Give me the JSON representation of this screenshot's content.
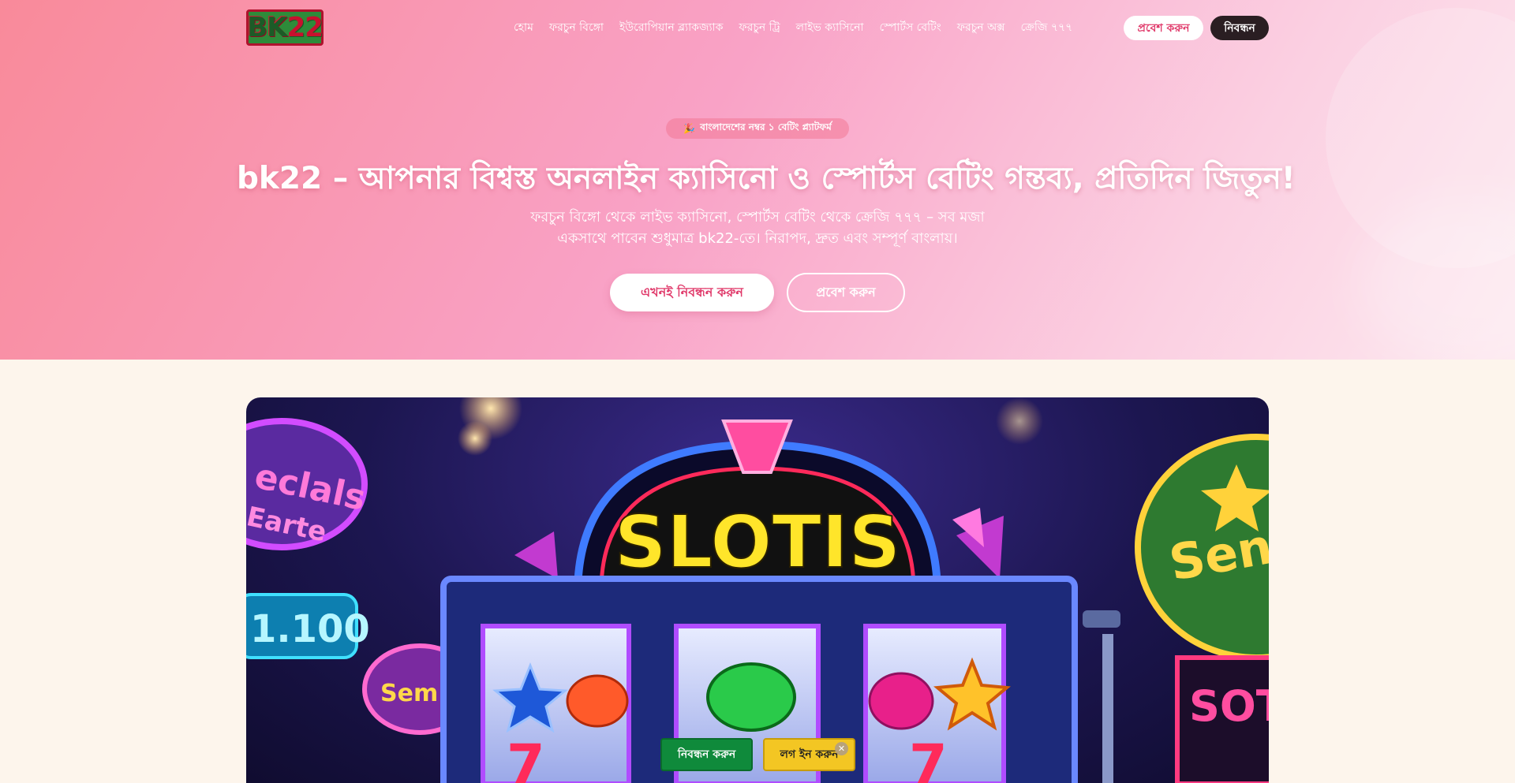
{
  "header": {
    "logo_text_a": "BK",
    "logo_text_b": "22",
    "nav": [
      "হোম",
      "ফরচুন বিঙ্গো",
      "ইউরোপিয়ান ব্ল্যাকজ্যাক",
      "ফরচুন ট্রি",
      "লাইভ ক্যাসিনো",
      "স্পোর্টস বেটিং",
      "ফরচুন অক্স",
      "ক্রেজি ৭৭৭"
    ],
    "login_label": "প্রবেশ করুন",
    "register_label": "নিবন্ধন"
  },
  "hero": {
    "badge_icon": "party-popper-icon",
    "badge_text": "বাংলাদেশের নম্বর ১ বেটিং প্ল্যাটফর্ম",
    "title": "bk22 – আপনার বিশ্বস্ত অনলাইন ক্যাসিনো ও স্পোর্টস বেটিং গন্তব্য, প্রতিদিন জিতুন!",
    "subtitle_line1": "ফরচুন বিঙ্গো থেকে লাইভ ক্যাসিনো, স্পোর্টস বেটিং থেকে ক্রেজি ৭৭৭ – সব মজা",
    "subtitle_line2": "একসাথে পাবেন শুধুমাত্র bk22-তে। নিরাপদ, দ্রুত এবং সম্পূর্ণ বাংলায়।",
    "cta_primary": "এখনই নিবন্ধন করুন",
    "cta_secondary": "প্রবেশ করুন"
  },
  "banner": {
    "sign_main": "SLOTIS",
    "sign_left_1": "eclals",
    "sign_left_2": "Earte",
    "sign_left_num": "1.100",
    "sign_left_small": "Sem",
    "sign_right_1": "Seni",
    "sign_right_2": "SOT"
  },
  "sticky": {
    "register_label": "নিবন্ধন করুন",
    "login_label": "লগ ইন করুন",
    "close_icon": "close-icon"
  },
  "colors": {
    "brand_pink": "#e0396a",
    "hero_gradient_start": "#f98a9a",
    "hero_gradient_end": "#fde8ef",
    "page_bg": "#fdf5ec",
    "sticky_green": "#0f8a3b",
    "sticky_yellow": "#f3c623",
    "dark_button": "#2a1e22"
  }
}
